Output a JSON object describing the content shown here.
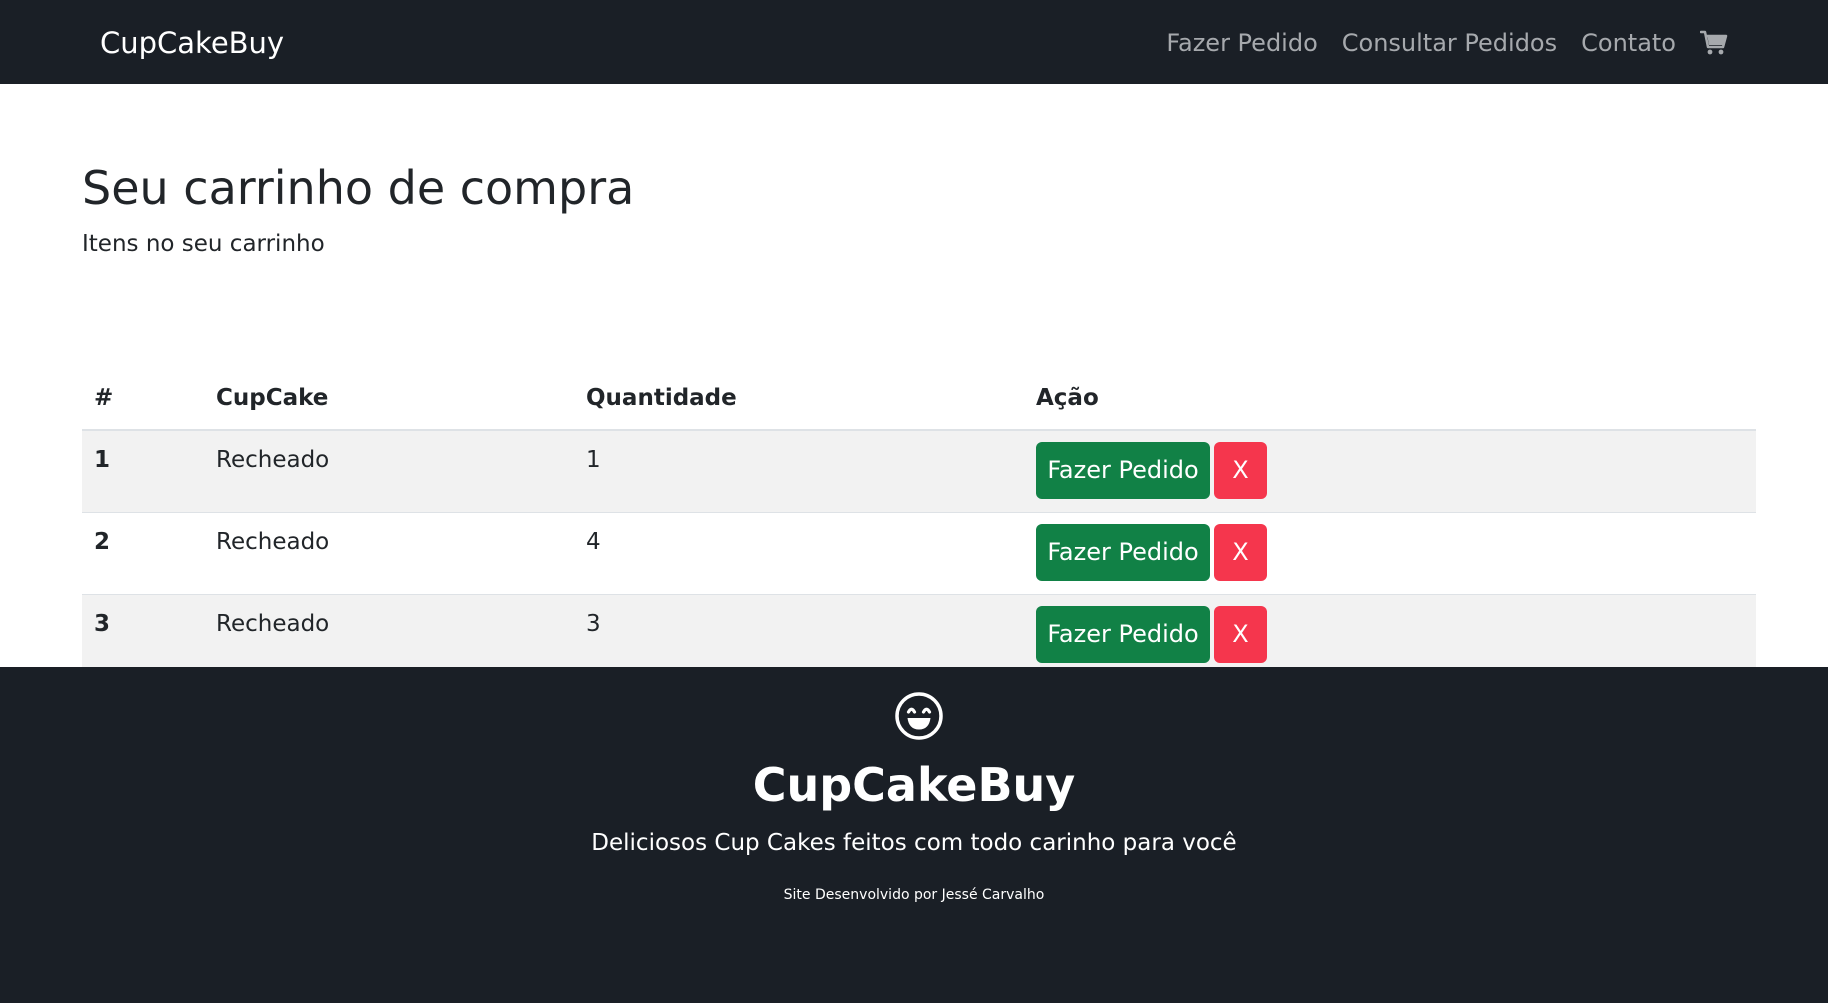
{
  "navbar": {
    "brand": "CupCakeBuy",
    "links": [
      "Fazer Pedido",
      "Consultar Pedidos",
      "Contato"
    ],
    "cart_icon": "shopping-cart-icon"
  },
  "main": {
    "title": "Seu carrinho de compra",
    "subtitle": "Itens no seu carrinho"
  },
  "table": {
    "headers": [
      "#",
      "CupCake",
      "Quantidade",
      "Ação"
    ],
    "rows": [
      {
        "index": "1",
        "cupcake": "Recheado",
        "quantity": "1",
        "order_label": "Fazer Pedido",
        "remove_label": "X"
      },
      {
        "index": "2",
        "cupcake": "Recheado",
        "quantity": "4",
        "order_label": "Fazer Pedido",
        "remove_label": "X"
      },
      {
        "index": "3",
        "cupcake": "Recheado",
        "quantity": "3",
        "order_label": "Fazer Pedido",
        "remove_label": "X"
      }
    ]
  },
  "footer": {
    "icon": "smile-icon",
    "brand": "CupCakeBuy",
    "tagline": "Deliciosos Cup Cakes feitos com todo carinho para você",
    "credit": "Site Desenvolvido por Jessé Carvalho"
  },
  "colors": {
    "dark_background": "#1a1f26",
    "order_button": "#118146",
    "remove_button": "#f5364d",
    "stripe": "#f2f2f2"
  }
}
